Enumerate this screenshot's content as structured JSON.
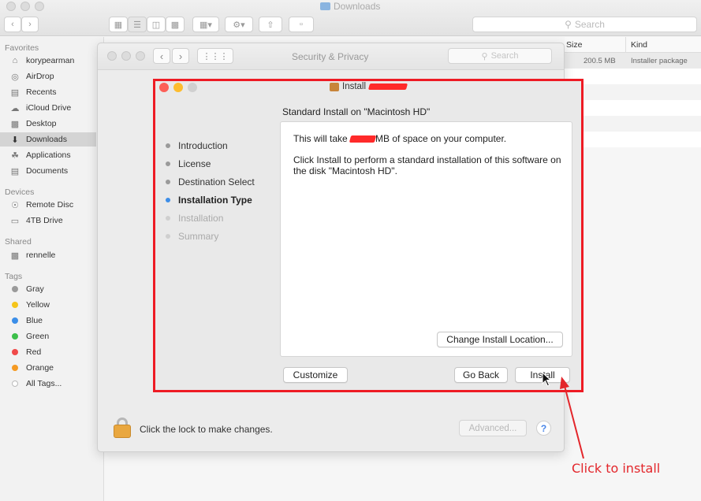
{
  "finder": {
    "title": "Downloads",
    "search_placeholder": "Search",
    "sidebar": {
      "favorites_heading": "Favorites",
      "favorites": [
        {
          "label": "korypearman",
          "icon": "home-icon"
        },
        {
          "label": "AirDrop",
          "icon": "airdrop-icon"
        },
        {
          "label": "Recents",
          "icon": "recents-icon"
        },
        {
          "label": "iCloud Drive",
          "icon": "cloud-icon"
        },
        {
          "label": "Desktop",
          "icon": "desktop-icon"
        },
        {
          "label": "Downloads",
          "icon": "downloads-icon"
        },
        {
          "label": "Applications",
          "icon": "applications-icon"
        },
        {
          "label": "Documents",
          "icon": "documents-icon"
        }
      ],
      "devices_heading": "Devices",
      "devices": [
        {
          "label": "Remote Disc",
          "icon": "disc-icon"
        },
        {
          "label": "4TB Drive",
          "icon": "drive-icon"
        }
      ],
      "shared_heading": "Shared",
      "shared": [
        {
          "label": "rennelle",
          "icon": "computer-icon"
        }
      ],
      "tags_heading": "Tags",
      "tags": [
        {
          "label": "Gray",
          "color": "#9a9a9a"
        },
        {
          "label": "Yellow",
          "color": "#f5c51b"
        },
        {
          "label": "Blue",
          "color": "#3b8ee8"
        },
        {
          "label": "Green",
          "color": "#3cbf4a"
        },
        {
          "label": "Red",
          "color": "#f04a4a"
        },
        {
          "label": "Orange",
          "color": "#f59a23"
        },
        {
          "label": "All Tags...",
          "color": "#cccccc"
        }
      ]
    },
    "columns": {
      "size": "Size",
      "kind": "Kind"
    },
    "file_row": {
      "size": "200.5 MB",
      "kind": "Installer package"
    }
  },
  "security_privacy": {
    "title": "Security & Privacy",
    "search_placeholder": "Search",
    "lock_text": "Click the lock to make changes.",
    "advanced_button": "Advanced...",
    "help_button": "?"
  },
  "installer": {
    "title_prefix": "Install",
    "subtitle": "Standard Install on \"Macintosh HD\"",
    "steps": [
      {
        "label": "Introduction",
        "state": "done"
      },
      {
        "label": "License",
        "state": "done"
      },
      {
        "label": "Destination Select",
        "state": "done"
      },
      {
        "label": "Installation Type",
        "state": "current"
      },
      {
        "label": "Installation",
        "state": "future"
      },
      {
        "label": "Summary",
        "state": "future"
      }
    ],
    "space_prefix": "This will take",
    "space_suffix": "MB of space on your computer.",
    "description": "Click Install to perform a standard installation of this software on the disk \"Macintosh HD\".",
    "change_location_button": "Change Install Location...",
    "customize_button": "Customize",
    "go_back_button": "Go Back",
    "install_button": "Install"
  },
  "annotation": {
    "label": "Click to install",
    "color": "#e3262b"
  }
}
